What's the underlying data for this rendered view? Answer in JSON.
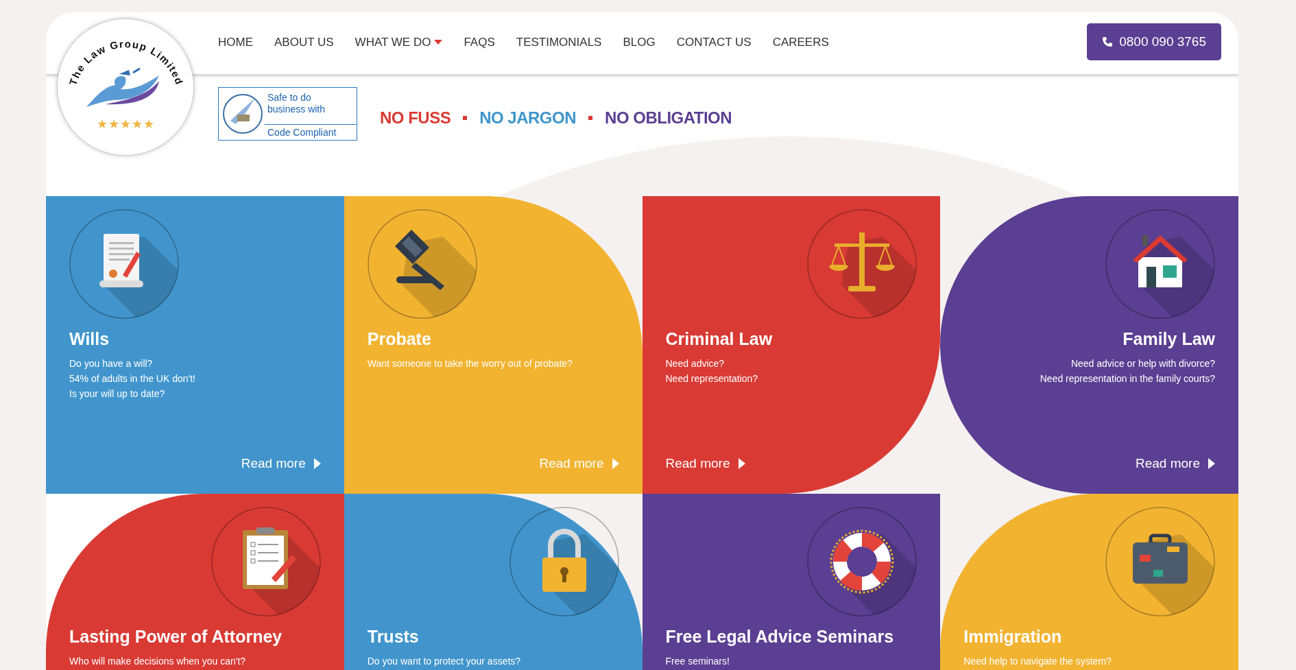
{
  "logo": {
    "name": "The Law Group Limited",
    "stars": 5
  },
  "nav": [
    {
      "label": "HOME",
      "has_dropdown": false
    },
    {
      "label": "ABOUT US",
      "has_dropdown": false
    },
    {
      "label": "WHAT WE DO",
      "has_dropdown": true
    },
    {
      "label": "FAQS",
      "has_dropdown": false
    },
    {
      "label": "TESTIMONIALS",
      "has_dropdown": false
    },
    {
      "label": "BLOG",
      "has_dropdown": false
    },
    {
      "label": "CONTACT US",
      "has_dropdown": false
    },
    {
      "label": "CAREERS",
      "has_dropdown": false
    }
  ],
  "phone": "0800 090 3765",
  "badge": {
    "lines": [
      "Safe to do",
      "business with"
    ],
    "footer": "Code Compliant"
  },
  "taglines": [
    {
      "text": "NO FUSS",
      "color": "#d93a33"
    },
    {
      "text": "NO JARGON",
      "color": "#3f95cb"
    },
    {
      "text": "NO OBLIGATION",
      "color": "#5a3f92"
    }
  ],
  "services": [
    {
      "title": "Wills",
      "description": [
        "Do you have a will?",
        "54% of adults in the UK don't!",
        "Is your will up to date?"
      ],
      "read_more": "Read more",
      "color": "#4195cc",
      "kind": "square"
    },
    {
      "title": "Probate",
      "description": [
        "Want someone to take the worry out of probate?"
      ],
      "read_more": "Read more",
      "color": "#f2b331",
      "kind": "topright"
    },
    {
      "title": "Criminal Law",
      "description": [
        "Need advice?",
        "Need representation?"
      ],
      "read_more": "Read more",
      "color": "#d93a34",
      "kind": "bottomright"
    },
    {
      "title": "Family Law",
      "description": [
        "Need advice or help with divorce?",
        "Need representation in the family courts?"
      ],
      "read_more": "Read more",
      "color": "#5a3f92",
      "kind": "leftround"
    },
    {
      "title": "Lasting Power of Attorney",
      "description": [
        "Who will make decisions when you can't?"
      ],
      "color": "#d93a34",
      "kind": "topleft"
    },
    {
      "title": "Trusts",
      "description": [
        "Do you want to protect your assets?"
      ],
      "color": "#4195cc",
      "kind": "topright"
    },
    {
      "title": "Free Legal Advice Seminars",
      "description": [
        "Free seminars!"
      ],
      "color": "#5a3f92",
      "kind": "square"
    },
    {
      "title": "Immigration",
      "description": [
        "Need help to navigate the system?"
      ],
      "color": "#f2b331",
      "kind": "topleft"
    }
  ]
}
